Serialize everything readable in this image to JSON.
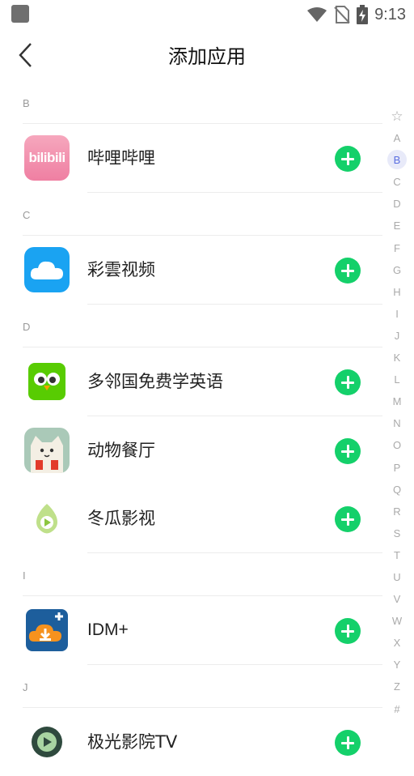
{
  "status_bar": {
    "time": "9:13"
  },
  "header": {
    "title": "添加应用"
  },
  "sections": [
    {
      "letter": "B",
      "apps": [
        {
          "name": "哔哩哔哩",
          "icon": "bilibili-icon"
        }
      ]
    },
    {
      "letter": "C",
      "apps": [
        {
          "name": "彩雲视频",
          "icon": "cloud-video-icon"
        }
      ]
    },
    {
      "letter": "D",
      "apps": [
        {
          "name": "多邻国免费学英语",
          "icon": "duolingo-icon"
        },
        {
          "name": "动物餐厅",
          "icon": "animal-restaurant-icon"
        },
        {
          "name": "冬瓜影视",
          "icon": "donggua-video-icon"
        }
      ]
    },
    {
      "letter": "I",
      "apps": [
        {
          "name": "IDM+",
          "icon": "idm-plus-icon"
        }
      ]
    },
    {
      "letter": "J",
      "apps": [
        {
          "name": "极光影院TV",
          "icon": "jiguang-cinema-icon"
        }
      ]
    }
  ],
  "alpha_index": [
    "☆",
    "A",
    "B",
    "C",
    "D",
    "E",
    "F",
    "G",
    "H",
    "I",
    "J",
    "K",
    "L",
    "M",
    "N",
    "O",
    "P",
    "Q",
    "R",
    "S",
    "T",
    "U",
    "V",
    "W",
    "X",
    "Y",
    "Z",
    "#"
  ],
  "alpha_index_active": "B",
  "colors": {
    "add_button": "#14d06a",
    "accent": "#5a6ee0"
  }
}
